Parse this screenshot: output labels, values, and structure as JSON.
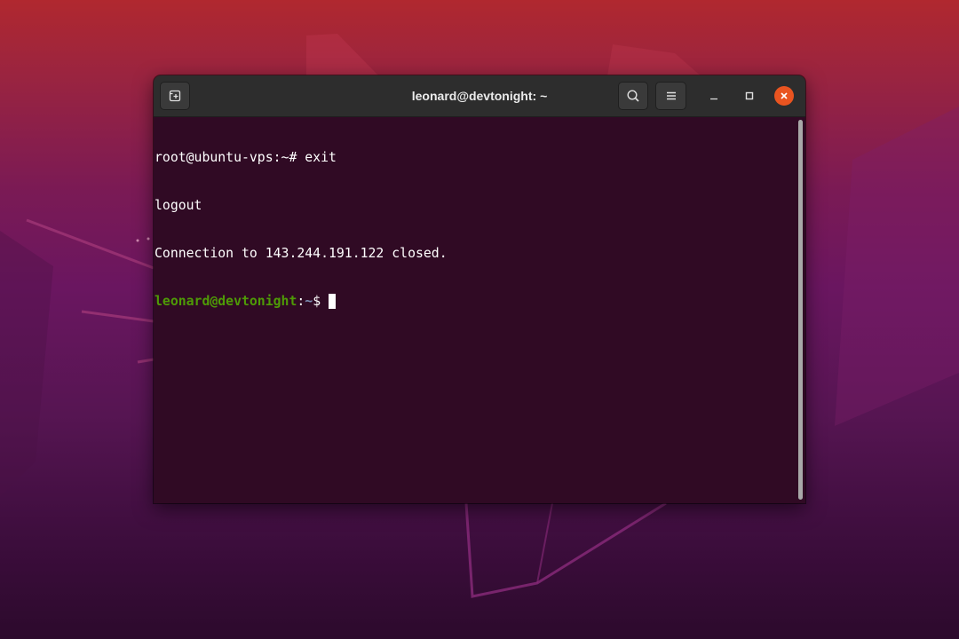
{
  "window": {
    "title": "leonard@devtonight: ~"
  },
  "header": {
    "new_tab_icon": "new-tab-icon",
    "search_icon": "search-icon",
    "menu_icon": "hamburger-menu-icon",
    "minimize_icon": "minimize-icon",
    "maximize_icon": "maximize-icon",
    "close_icon": "close-icon"
  },
  "terminal": {
    "lines": [
      {
        "text": "root@ubuntu-vps:~# exit"
      },
      {
        "text": "logout"
      },
      {
        "text": "Connection to 143.244.191.122 closed."
      }
    ],
    "prompt": {
      "user_host": "leonard@devtonight",
      "separator": ":",
      "path": "~",
      "symbol": "$ "
    }
  },
  "colors": {
    "terminal_bg": "#300a24",
    "prompt_green": "#4e9a06",
    "prompt_path": "#7d8fb4",
    "close_orange": "#e95420",
    "headerbar": "#2d2d2d"
  }
}
